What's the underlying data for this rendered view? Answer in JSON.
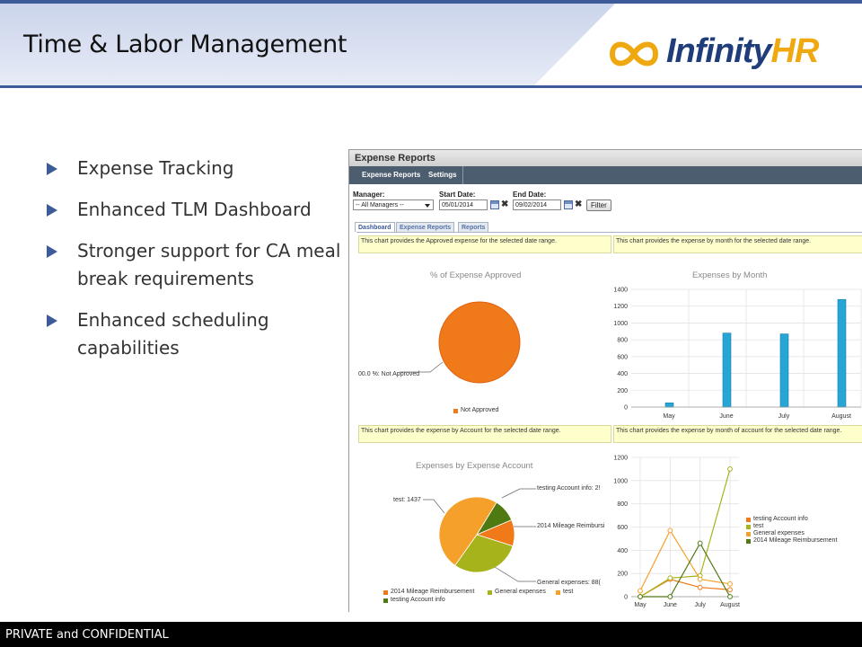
{
  "slide": {
    "title": "Time & Labor Management",
    "logo": {
      "brand": "Infinity",
      "brand_accent": "HR"
    },
    "bullets": [
      "Expense Tracking",
      "Enhanced TLM Dashboard",
      "Stronger support for CA meal break requirements",
      "Enhanced scheduling capabilities"
    ],
    "footer": "PRIVATE and CONFIDENTIAL"
  },
  "app": {
    "window_title": "Expense Reports",
    "nav": [
      "Expense Reports",
      "Settings"
    ],
    "filters": {
      "manager_label": "Manager:",
      "manager_value": "-- All Managers --",
      "start_label": "Start Date:",
      "start_value": "05/01/2014",
      "end_label": "End Date:",
      "end_value": "09/02/2014",
      "filter_button": "Filter"
    },
    "tabs": [
      "Dashboard",
      "Expense Reports",
      "Reports"
    ],
    "active_tab": "Dashboard",
    "info": {
      "approved": "This chart provides the Approved expense for the selected date range.",
      "by_month": "This chart provides the expense by month for the selected date range.",
      "by_account": "This chart provides the expense by Account for the selected date range.",
      "by_month_account": "This chart provides the expense by month of account for the selected date range."
    }
  },
  "colors": {
    "accent": "#3d5a99",
    "logo_accent": "#f0a810",
    "bar": "#27a6d6",
    "orange": "#f07a1a",
    "olive": "#a6b31b",
    "light_orange": "#f5a02a",
    "dark_green": "#4f7a12"
  },
  "chart_data": [
    {
      "type": "pie",
      "title": "% of Expense Approved",
      "slices": [
        {
          "label": "Not Approved",
          "value": 100,
          "color": "#f07a1a"
        }
      ],
      "data_label": "00.0 %: Not Approved",
      "legend": [
        "Not Approved"
      ]
    },
    {
      "type": "bar",
      "title": "Expenses by Month",
      "categories": [
        "May",
        "June",
        "July",
        "August"
      ],
      "values": [
        50,
        880,
        870,
        1280
      ],
      "ylim": [
        0,
        1400
      ],
      "yticks": [
        "1400",
        "1200",
        "1000",
        "800",
        "600",
        "400",
        "200",
        "0"
      ],
      "grid": true
    },
    {
      "type": "pie",
      "title": "Expenses by Expense Account",
      "slices": [
        {
          "label": "test",
          "value": 1437,
          "color": "#f5a02a"
        },
        {
          "label": "2014 Mileage Reimbursement",
          "value": 330,
          "color": "#f07a1a"
        },
        {
          "label": "General expenses",
          "value": 880,
          "color": "#a6b31b"
        },
        {
          "label": "testing Account info",
          "value": 290,
          "color": "#4f7a12"
        }
      ],
      "data_labels": [
        "test: 1437",
        "testing Account info: 2!",
        "2014 Mileage Reimbursi",
        "General expenses: 88("
      ],
      "legend": [
        "2014 Mileage Reimbursement",
        "General expenses",
        "test",
        "testing Account info"
      ]
    },
    {
      "type": "line",
      "categories": [
        "May",
        "June",
        "July",
        "August"
      ],
      "ylim": [
        0,
        1200
      ],
      "yticks": [
        "1200",
        "1000",
        "800",
        "600",
        "400",
        "200",
        "0"
      ],
      "series": [
        {
          "name": "testing Account info",
          "values": [
            0,
            150,
            80,
            60
          ],
          "color": "#f07a1a"
        },
        {
          "name": "test",
          "values": [
            0,
            160,
            180,
            1100
          ],
          "color": "#a6b31b"
        },
        {
          "name": "General expenses",
          "values": [
            50,
            570,
            150,
            110
          ],
          "color": "#f5a02a"
        },
        {
          "name": "2014 Mileage Reimbursement",
          "values": [
            0,
            0,
            460,
            0
          ],
          "color": "#4f7a12"
        }
      ],
      "legend": [
        "testing Account info",
        "test",
        "General expenses",
        "2014 Mileage Reimbursement"
      ],
      "legend_position": "right",
      "grid": true
    }
  ]
}
